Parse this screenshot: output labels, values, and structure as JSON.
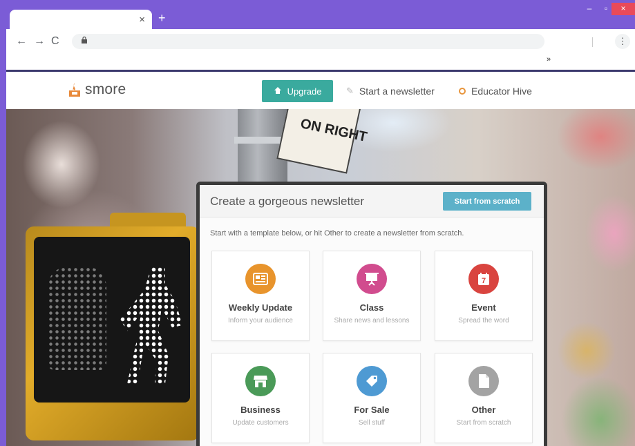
{
  "browser": {
    "tab_close": "×",
    "new_tab": "+",
    "window": {
      "minimize": "–",
      "maximize": "▫",
      "close": "×"
    },
    "nav": {
      "back": "←",
      "forward": "→",
      "reload": "C"
    },
    "lock": "🔒",
    "menu": "⋮",
    "bookmarks_overflow": "»"
  },
  "site": {
    "logo_text": "smore",
    "upgrade_label": "Upgrade",
    "start_newsletter_label": "Start a newsletter",
    "educator_hive_label": "Educator Hive"
  },
  "hero": {
    "sign_text": "ON RIGHT"
  },
  "panel": {
    "title": "Create a gorgeous newsletter",
    "scratch_button": "Start from scratch",
    "subtitle": "Start with a template below, or hit Other to create a newsletter from scratch."
  },
  "templates": [
    {
      "title": "Weekly Update",
      "desc": "Inform your audience",
      "icon": "newspaper-icon",
      "color": "#e8942c"
    },
    {
      "title": "Class",
      "desc": "Share news and lessons",
      "icon": "presentation-icon",
      "color": "#d14c8e"
    },
    {
      "title": "Event",
      "desc": "Spread the word",
      "icon": "calendar-icon",
      "color": "#d9443f"
    },
    {
      "title": "Business",
      "desc": "Update customers",
      "icon": "storefront-icon",
      "color": "#4a9a58"
    },
    {
      "title": "For Sale",
      "desc": "Sell stuff",
      "icon": "price-tag-icon",
      "color": "#4e9ad3"
    },
    {
      "title": "Other",
      "desc": "Start from scratch",
      "icon": "document-icon",
      "color": "#a3a3a3"
    }
  ],
  "calendar_day": "7"
}
